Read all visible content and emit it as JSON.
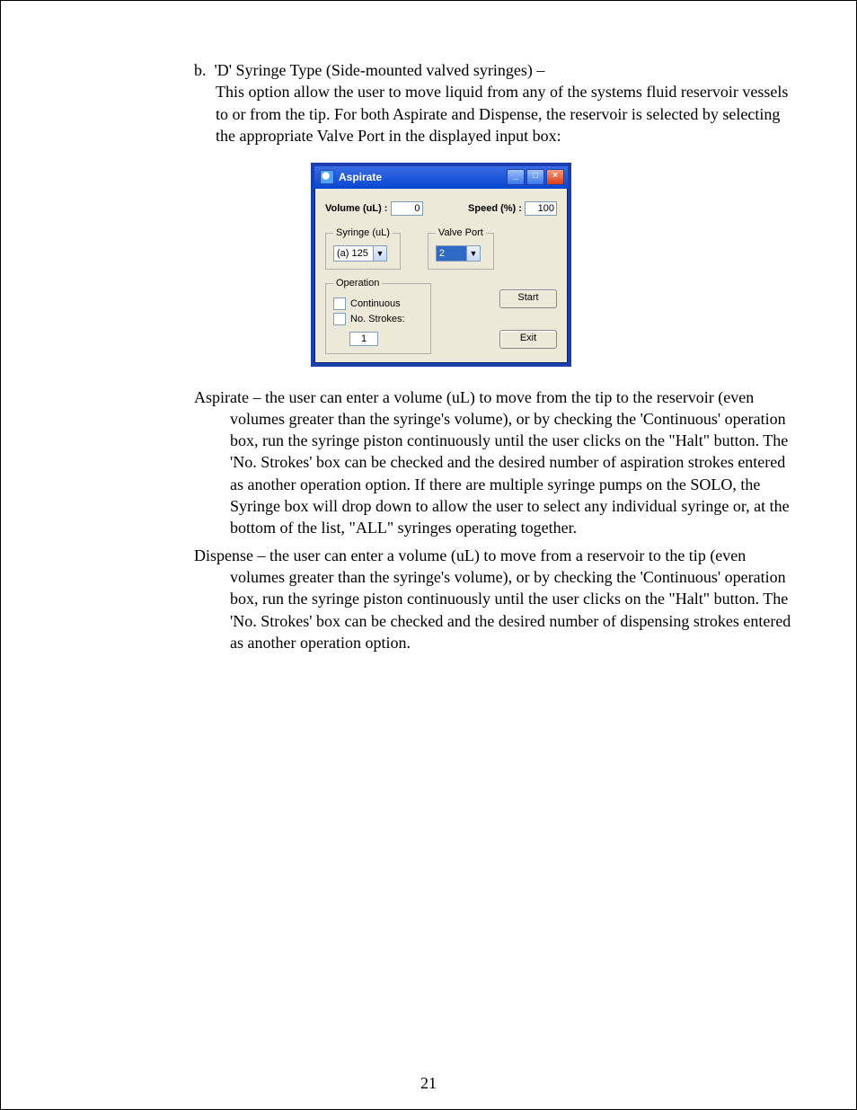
{
  "body": {
    "item_letter": "b.",
    "heading": "'D' Syringe Type (Side-mounted valved syringes) –",
    "intro": "This option allow the user to move liquid from any of the systems fluid reservoir vessels to or from the tip.  For both Aspirate and Dispense, the reservoir is selected by selecting the appropriate Valve Port in the displayed input box:",
    "aspirate_para": "Aspirate – the user can enter a volume (uL) to move from the tip to the reservoir (even volumes greater than the syringe's volume), or by checking the 'Continuous' operation box,  run the syringe piston continuously until the user clicks on the \"Halt\" button.  The 'No. Strokes' box can be checked and the desired number of aspiration strokes entered as another operation option. If there are multiple syringe pumps on the SOLO,  the Syringe box will drop down to allow the user to select any individual syringe or, at the bottom of the list, \"ALL\" syringes operating together.",
    "dispense_para": "Dispense – the user can enter a volume (uL) to move from a reservoir to the tip (even volumes greater than the syringe's volume), or by checking the 'Continuous' operation box,  run the syringe piston continuously until the user clicks on the \"Halt\" button.  The 'No. Strokes' box can be checked and the desired number of dispensing strokes  entered as another operation option."
  },
  "dialog": {
    "title": "Aspirate",
    "volume_label": "Volume (uL) :",
    "volume_value": "0",
    "speed_label": "Speed (%) :",
    "speed_value": "100",
    "syringe_legend": "Syringe (uL)",
    "syringe_value": "(a) 125",
    "valve_legend": "Valve Port",
    "valve_value": "2",
    "operation_legend": "Operation",
    "continuous_label": "Continuous",
    "nostrokes_label": "No. Strokes:",
    "nostrokes_value": "1",
    "start_label": "Start",
    "exit_label": "Exit"
  },
  "page_number": "21"
}
